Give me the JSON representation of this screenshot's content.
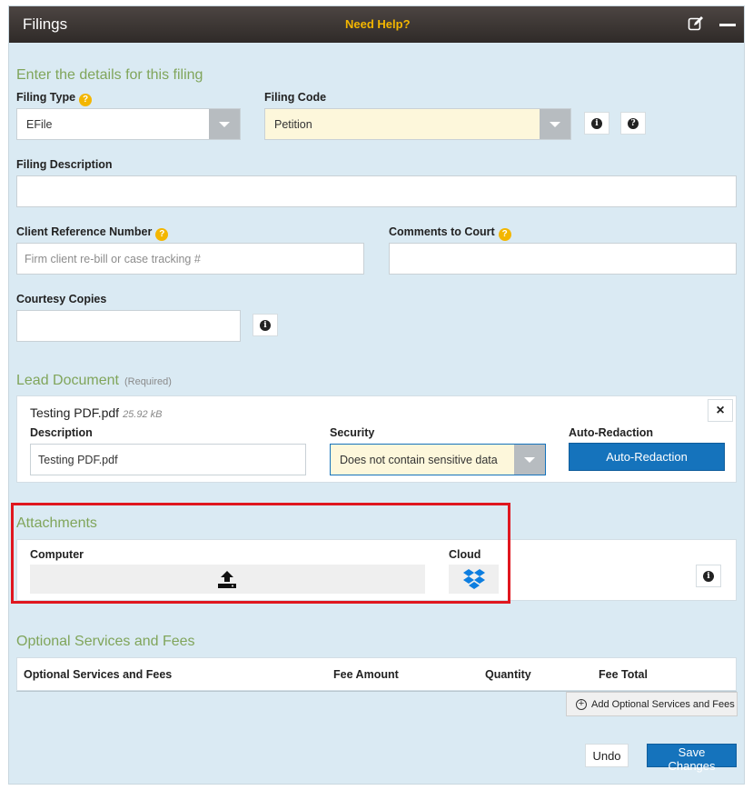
{
  "header": {
    "title": "Filings",
    "help": "Need Help?"
  },
  "details": {
    "section_title": "Enter the details for this filing",
    "filing_type_label": "Filing Type",
    "filing_type_value": "EFile",
    "filing_code_label": "Filing Code",
    "filing_code_value": "Petition",
    "filing_description_label": "Filing Description",
    "filing_description_value": "",
    "client_ref_label": "Client Reference Number",
    "client_ref_placeholder": "Firm client re-bill or case tracking #",
    "comments_label": "Comments to Court",
    "comments_value": "",
    "courtesy_label": "Courtesy Copies",
    "courtesy_value": ""
  },
  "lead_document": {
    "section_title": "Lead Document",
    "required_note": "(Required)",
    "file_name": "Testing PDF.pdf",
    "file_size": "25.92 kB",
    "description_label": "Description",
    "description_value": "Testing PDF.pdf",
    "security_label": "Security",
    "security_value": "Does not contain sensitive data",
    "auto_redaction_label": "Auto-Redaction",
    "auto_redaction_button": "Auto-Redaction",
    "close_glyph": "×"
  },
  "attachments": {
    "section_title": "Attachments",
    "computer_label": "Computer",
    "cloud_label": "Cloud"
  },
  "optional_services": {
    "section_title": "Optional Services and Fees",
    "columns": [
      "Optional Services and Fees",
      "Fee Amount",
      "Quantity",
      "Fee Total"
    ],
    "add_button": "Add Optional Services and Fees"
  },
  "footer": {
    "undo": "Undo",
    "save": "Save Changes"
  },
  "icons": {
    "question": "?",
    "info": "i",
    "question_dark": "?"
  },
  "colors": {
    "header_bg": "#3a3432",
    "help": "#f3b600",
    "panel_bg": "#daeaf3",
    "section_title": "#80a55b",
    "primary_button": "#1573bc",
    "highlight": "#e0171f",
    "filing_code_bg": "#fdf7db",
    "dropbox": "#0d7ee0"
  }
}
